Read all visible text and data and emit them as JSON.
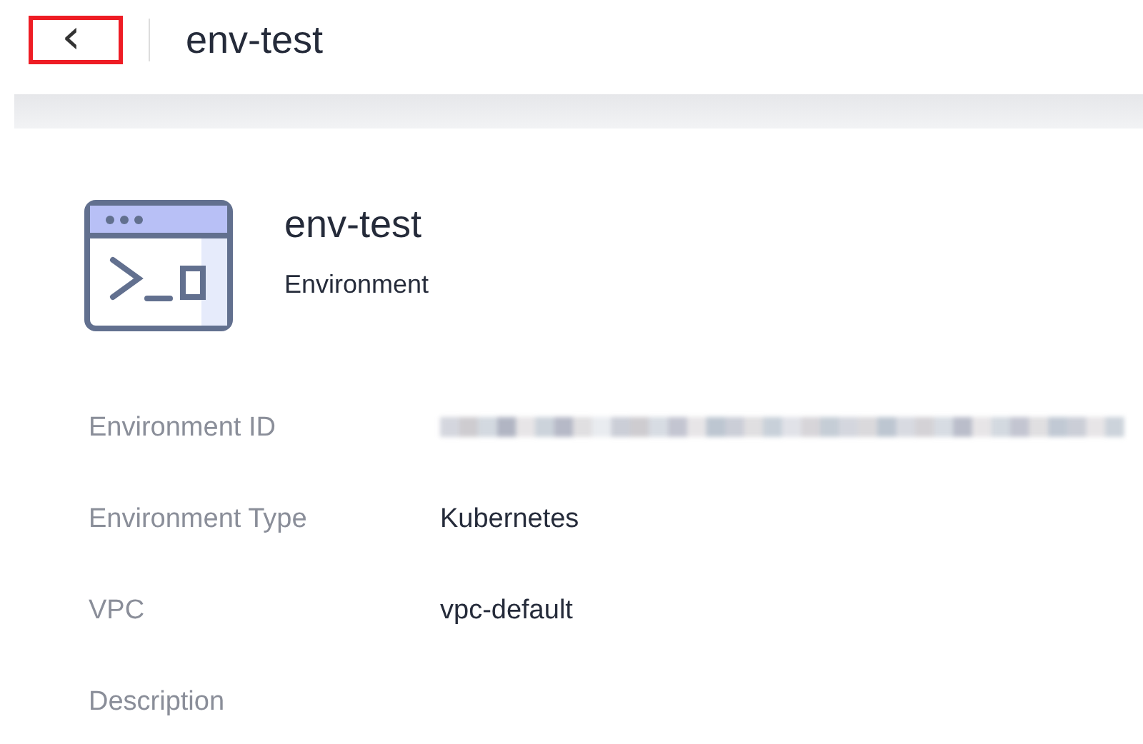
{
  "header": {
    "back_button": {
      "icon": "‹",
      "highlighted": true
    },
    "title": "env-test"
  },
  "summary": {
    "name": "env-test",
    "type": "Environment"
  },
  "fields": [
    {
      "label": "Environment ID",
      "redacted": true
    },
    {
      "label": "Environment Type",
      "value": "Kubernetes",
      "redacted": false
    },
    {
      "label": "VPC",
      "value": "vpc-default",
      "redacted": false
    },
    {
      "label": "Description",
      "redacted": false
    }
  ]
}
